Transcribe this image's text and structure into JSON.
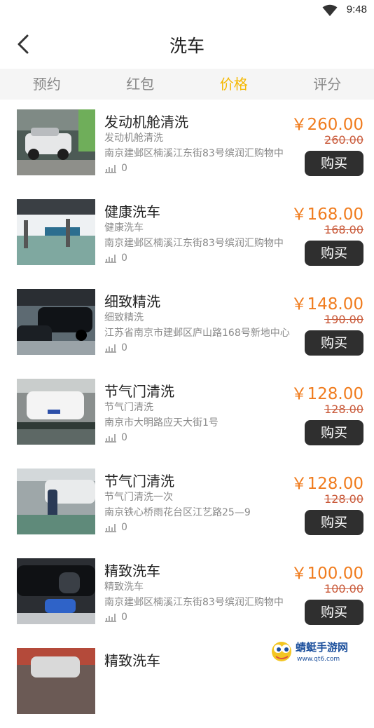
{
  "status_bar": {
    "time": "9:48"
  },
  "nav": {
    "title": "洗车"
  },
  "tabs": [
    {
      "label": "预约"
    },
    {
      "label": "红包"
    },
    {
      "label": "价格"
    },
    {
      "label": "评分"
    }
  ],
  "active_tab": "价格",
  "colors": {
    "accent": "#f5b800",
    "price": "#f07c1e",
    "button": "#2f2f2f"
  },
  "items": [
    {
      "name": "发动机舱清洗",
      "subtitle": "发动机舱清洗",
      "address": "南京建邺区楠溪江东街83号缤润汇购物中",
      "sales": "0",
      "price": "￥260.00",
      "original": "260.00",
      "buy": "购买"
    },
    {
      "name": "健康洗车",
      "subtitle": "健康洗车",
      "address": "南京建邺区楠溪江东街83号缤润汇购物中",
      "sales": "0",
      "price": "￥168.00",
      "original": "168.00",
      "buy": "购买"
    },
    {
      "name": "细致精洗",
      "subtitle": "细致精洗",
      "address": "江苏省南京市建邺区庐山路168号新地中心",
      "sales": "0",
      "price": "￥148.00",
      "original": "190.00",
      "buy": "购买"
    },
    {
      "name": "节气门清洗",
      "subtitle": "节气门清洗",
      "address": "南京市大明路应天大街1号",
      "sales": "0",
      "price": "￥128.00",
      "original": "128.00",
      "buy": "购买"
    },
    {
      "name": "节气门清洗",
      "subtitle": "节气门清洗一次",
      "address": "南京铁心桥雨花台区江艺路25—9",
      "sales": "0",
      "price": "￥128.00",
      "original": "128.00",
      "buy": "购买"
    },
    {
      "name": "精致洗车",
      "subtitle": "精致洗车",
      "address": "南京建邺区楠溪江东街83号缤润汇购物中",
      "sales": "0",
      "price": "￥100.00",
      "original": "100.00",
      "buy": "购买"
    },
    {
      "name": "精致洗车",
      "subtitle": "",
      "address": "",
      "sales": "",
      "price": "",
      "original": "",
      "buy": ""
    }
  ],
  "watermark": {
    "text": "蜻蜓手游网",
    "url": "www.qt6.com"
  }
}
